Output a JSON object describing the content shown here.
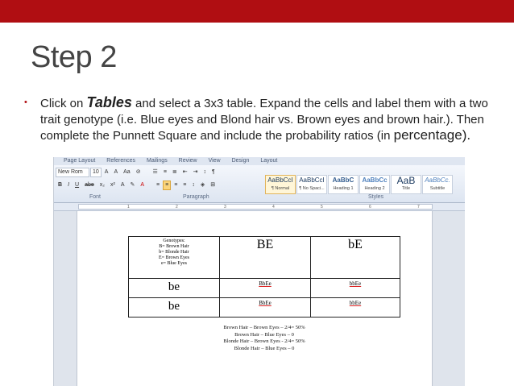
{
  "slide": {
    "title": "Step 2",
    "bullet": {
      "part1": "Click on ",
      "keyword": "Tables",
      "part2": " and select a 3x3 table.  Expand the cells and label them with a two trait genotype (i.e. Blue eyes and Blond hair vs. Brown eyes and brown hair.).  Then complete the Punnett Square and include the probability ratios (in ",
      "keyword2": "percentage",
      "part3": ")."
    }
  },
  "colors": {
    "accent_bar": "#b00e12",
    "title": "#444444"
  },
  "word": {
    "tabs": [
      "Page Layout",
      "References",
      "Mailings",
      "Review",
      "View",
      "Design",
      "Layout"
    ],
    "ribbon": {
      "font_name": "New Rom",
      "font_size": "10",
      "strike_label": "abe",
      "groups": [
        "Font",
        "Paragraph",
        "Styles"
      ],
      "styles": [
        {
          "sample": "AaBbCcI",
          "name": "¶ Normal"
        },
        {
          "sample": "AaBbCcI",
          "name": "¶ No Spaci..."
        },
        {
          "sample": "AaBbC",
          "name": "Heading 1"
        },
        {
          "sample": "AaBbCc",
          "name": "Heading 2"
        },
        {
          "sample": "AaB",
          "name": "Title"
        },
        {
          "sample": "AaBbCc.",
          "name": "Subtitle"
        }
      ]
    },
    "ruler_marks": [
      "1",
      "2",
      "3",
      "4",
      "5",
      "6",
      "7"
    ],
    "table": {
      "legend_title": "Genotypes:",
      "legend_lines": [
        "B= Brown Hair",
        "b= Blonde Hair",
        "E= Brown Eyes",
        "e= Blue Eyes"
      ],
      "headers": [
        "BE",
        "bE"
      ],
      "rows": [
        {
          "label": "be",
          "cells": [
            "BbEe",
            "bbEe"
          ]
        },
        {
          "label": "be",
          "cells": [
            "BbEe",
            "bbEe"
          ]
        }
      ]
    },
    "probabilities": [
      "Brown Hair – Brown Eyes – 2/4= 50%",
      "Brown Hair – Blue Eyes – 0",
      "Blonde Hair – Brown Eyes - 2/4= 50%",
      "Blonde Hair – Blue Eyes – 0"
    ]
  }
}
